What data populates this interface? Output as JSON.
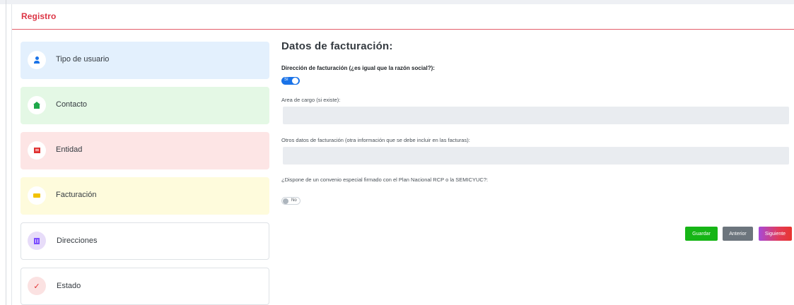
{
  "panel": {
    "title": "Registro"
  },
  "steps": [
    {
      "label": "Tipo de usuario",
      "icon": "user-icon",
      "color": "#e3f0fd"
    },
    {
      "label": "Contacto",
      "icon": "home-icon",
      "color": "#e4f8e5"
    },
    {
      "label": "Entidad",
      "icon": "building-icon",
      "color": "#fde5e5"
    },
    {
      "label": "Facturación",
      "icon": "card-icon",
      "color": "#fefbdc"
    },
    {
      "label": "Direcciones",
      "icon": "bank-icon",
      "color": "#ffffff"
    },
    {
      "label": "Estado",
      "icon": "check-icon",
      "color": "#ffffff"
    }
  ],
  "form": {
    "title": "Datos de facturación:",
    "billing_address_question": "Dirección de facturación (¿es igual que la razón social?):",
    "billing_address_toggle": {
      "state": "on",
      "text": "Sí"
    },
    "area_label": "Area de cargo (si existe):",
    "area_value": "",
    "otros_label": "Otros datos de facturación (otra información que se debe incluir en las facturas):",
    "otros_value": "",
    "convenio_label": "¿Dispone de un convenio especial firmado con el Plan Nacional RCP o la SEMICYUC?:",
    "convenio_toggle": {
      "state": "off",
      "text": "No"
    }
  },
  "buttons": {
    "save": "Guardar",
    "prev": "Anterior",
    "next": "Siguiente"
  },
  "colors": {
    "accent": "#dc3545",
    "primary": "#1a73e8",
    "save": "#16b516",
    "prev": "#6c757d"
  }
}
